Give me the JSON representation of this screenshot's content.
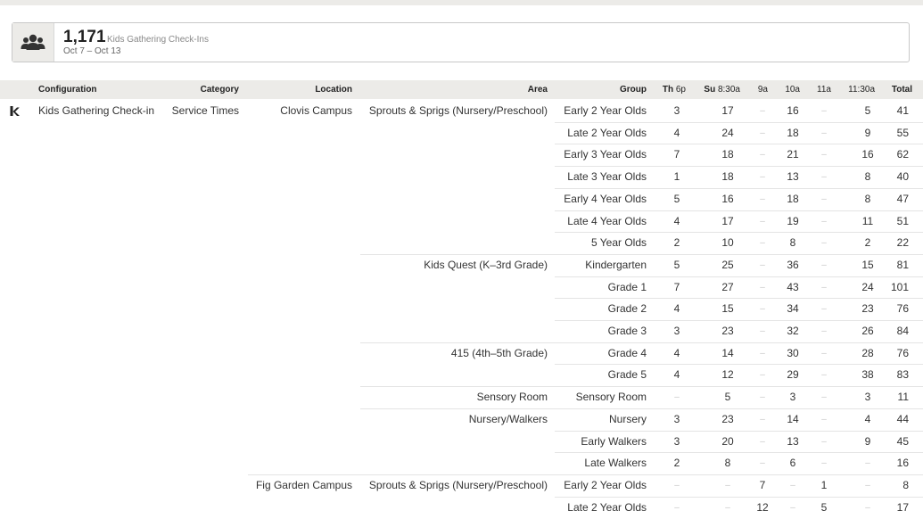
{
  "summary": {
    "count": "1,171",
    "label": "Kids Gathering Check-Ins",
    "dates": "Oct 7 – Oct 13",
    "icon": "people-group-icon"
  },
  "columns": {
    "configuration": "Configuration",
    "category": "Category",
    "location": "Location",
    "area": "Area",
    "group": "Group",
    "times": [
      {
        "day": "Th",
        "time": "6p"
      },
      {
        "day": "Su",
        "time": "8:30a"
      },
      {
        "day": "",
        "time": "9a"
      },
      {
        "day": "",
        "time": "10a"
      },
      {
        "day": "",
        "time": "11a"
      },
      {
        "day": "",
        "time": "11:30a"
      }
    ],
    "total": "Total"
  },
  "rows": [
    {
      "configuration": "Kids Gathering Check-in",
      "category": "Service Times",
      "location": "Clovis Campus",
      "area": "Sprouts & Sprigs (Nursery/Preschool)",
      "group": "Early 2 Year Olds",
      "values": [
        "3",
        "17",
        "–",
        "16",
        "–",
        "5"
      ],
      "total": "41"
    },
    {
      "configuration": "",
      "category": "",
      "location": "",
      "area": "",
      "group": "Late 2 Year Olds",
      "values": [
        "4",
        "24",
        "–",
        "18",
        "–",
        "9"
      ],
      "total": "55"
    },
    {
      "configuration": "",
      "category": "",
      "location": "",
      "area": "",
      "group": "Early 3 Year Olds",
      "values": [
        "7",
        "18",
        "–",
        "21",
        "–",
        "16"
      ],
      "total": "62"
    },
    {
      "configuration": "",
      "category": "",
      "location": "",
      "area": "",
      "group": "Late 3 Year Olds",
      "values": [
        "1",
        "18",
        "–",
        "13",
        "–",
        "8"
      ],
      "total": "40"
    },
    {
      "configuration": "",
      "category": "",
      "location": "",
      "area": "",
      "group": "Early 4 Year Olds",
      "values": [
        "5",
        "16",
        "–",
        "18",
        "–",
        "8"
      ],
      "total": "47"
    },
    {
      "configuration": "",
      "category": "",
      "location": "",
      "area": "",
      "group": "Late 4 Year Olds",
      "values": [
        "4",
        "17",
        "–",
        "19",
        "–",
        "11"
      ],
      "total": "51"
    },
    {
      "configuration": "",
      "category": "",
      "location": "",
      "area": "",
      "group": "5 Year Olds",
      "values": [
        "2",
        "10",
        "–",
        "8",
        "–",
        "2"
      ],
      "total": "22"
    },
    {
      "configuration": "",
      "category": "",
      "location": "",
      "area": "Kids Quest (K–3rd Grade)",
      "group": "Kindergarten",
      "values": [
        "5",
        "25",
        "–",
        "36",
        "–",
        "15"
      ],
      "total": "81"
    },
    {
      "configuration": "",
      "category": "",
      "location": "",
      "area": "",
      "group": "Grade 1",
      "values": [
        "7",
        "27",
        "–",
        "43",
        "–",
        "24"
      ],
      "total": "101"
    },
    {
      "configuration": "",
      "category": "",
      "location": "",
      "area": "",
      "group": "Grade 2",
      "values": [
        "4",
        "15",
        "–",
        "34",
        "–",
        "23"
      ],
      "total": "76"
    },
    {
      "configuration": "",
      "category": "",
      "location": "",
      "area": "",
      "group": "Grade 3",
      "values": [
        "3",
        "23",
        "–",
        "32",
        "–",
        "26"
      ],
      "total": "84"
    },
    {
      "configuration": "",
      "category": "",
      "location": "",
      "area": "415 (4th–5th Grade)",
      "group": "Grade 4",
      "values": [
        "4",
        "14",
        "–",
        "30",
        "–",
        "28"
      ],
      "total": "76"
    },
    {
      "configuration": "",
      "category": "",
      "location": "",
      "area": "",
      "group": "Grade 5",
      "values": [
        "4",
        "12",
        "–",
        "29",
        "–",
        "38"
      ],
      "total": "83"
    },
    {
      "configuration": "",
      "category": "",
      "location": "",
      "area": "Sensory Room",
      "group": "Sensory Room",
      "values": [
        "–",
        "5",
        "–",
        "3",
        "–",
        "3"
      ],
      "total": "11"
    },
    {
      "configuration": "",
      "category": "",
      "location": "",
      "area": "Nursery/Walkers",
      "group": "Nursery",
      "values": [
        "3",
        "23",
        "–",
        "14",
        "–",
        "4"
      ],
      "total": "44"
    },
    {
      "configuration": "",
      "category": "",
      "location": "",
      "area": "",
      "group": "Early Walkers",
      "values": [
        "3",
        "20",
        "–",
        "13",
        "–",
        "9"
      ],
      "total": "45"
    },
    {
      "configuration": "",
      "category": "",
      "location": "",
      "area": "",
      "group": "Late Walkers",
      "values": [
        "2",
        "8",
        "–",
        "6",
        "–",
        "–"
      ],
      "total": "16"
    },
    {
      "configuration": "",
      "category": "",
      "location": "Fig Garden Campus",
      "area": "Sprouts & Sprigs (Nursery/Preschool)",
      "group": "Early 2 Year Olds",
      "values": [
        "–",
        "–",
        "7",
        "–",
        "1",
        "–"
      ],
      "total": "8"
    },
    {
      "configuration": "",
      "category": "",
      "location": "",
      "area": "",
      "group": "Late 2 Year Olds",
      "values": [
        "–",
        "–",
        "12",
        "–",
        "5",
        "–"
      ],
      "total": "17"
    }
  ]
}
